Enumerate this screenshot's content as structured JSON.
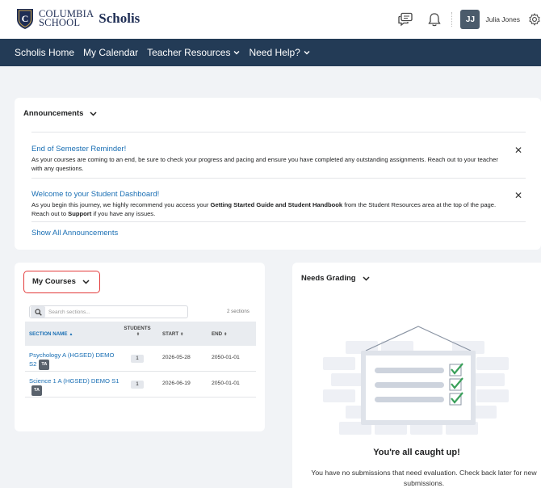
{
  "header": {
    "school_line1": "COLUMBIA",
    "school_line2": "SCHOOL",
    "brand": "Scholis",
    "user_initials": "JJ",
    "user_name": "Julia Jones"
  },
  "nav": {
    "items": [
      {
        "label": "Scholis Home"
      },
      {
        "label": "My Calendar"
      },
      {
        "label": "Teacher Resources"
      },
      {
        "label": "Need Help?"
      }
    ]
  },
  "announcements": {
    "title": "Announcements",
    "items": [
      {
        "title": "End of Semester Reminder!",
        "body": "As your courses are coming to an end, be sure to check your progress and pacing and ensure you have completed any outstanding assignments. Reach out to your teacher with any questions."
      },
      {
        "title": "Welcome to your Student Dashboard!",
        "body_pre": "As you begin this journey, we highly recommend you access your ",
        "body_bold1": "Getting Started Guide and Student Handbook",
        "body_mid": " from the Student Resources area at the top of the page. Reach out to ",
        "body_bold2": "Support",
        "body_post": " if you have any issues."
      }
    ],
    "show_all": "Show All Announcements"
  },
  "courses": {
    "title": "My Courses",
    "search_placeholder": "Search sections...",
    "count": "2 sections",
    "columns": {
      "section_name": "SECTION NAME",
      "students_line1": "STUDENTS",
      "start": "START",
      "end": "END"
    },
    "rows": [
      {
        "name": "Psychology A (HGSED) DEMO S2",
        "badge": "TA",
        "students": "1",
        "start": "2026-05-28",
        "end": "2050-01-01"
      },
      {
        "name": "Science 1 A (HGSED) DEMO S1",
        "badge": "TA",
        "students": "1",
        "start": "2026-06-19",
        "end": "2050-01-01"
      }
    ]
  },
  "grading": {
    "title": "Needs Grading",
    "empty_title": "You're all caught up!",
    "empty_text": "You have no submissions that need evaluation. Check back later for new submissions."
  },
  "colors": {
    "nav_bg": "#233b56",
    "link": "#1a6fb4",
    "highlight_border": "#e33b3b",
    "check_green": "#3aa05a"
  }
}
